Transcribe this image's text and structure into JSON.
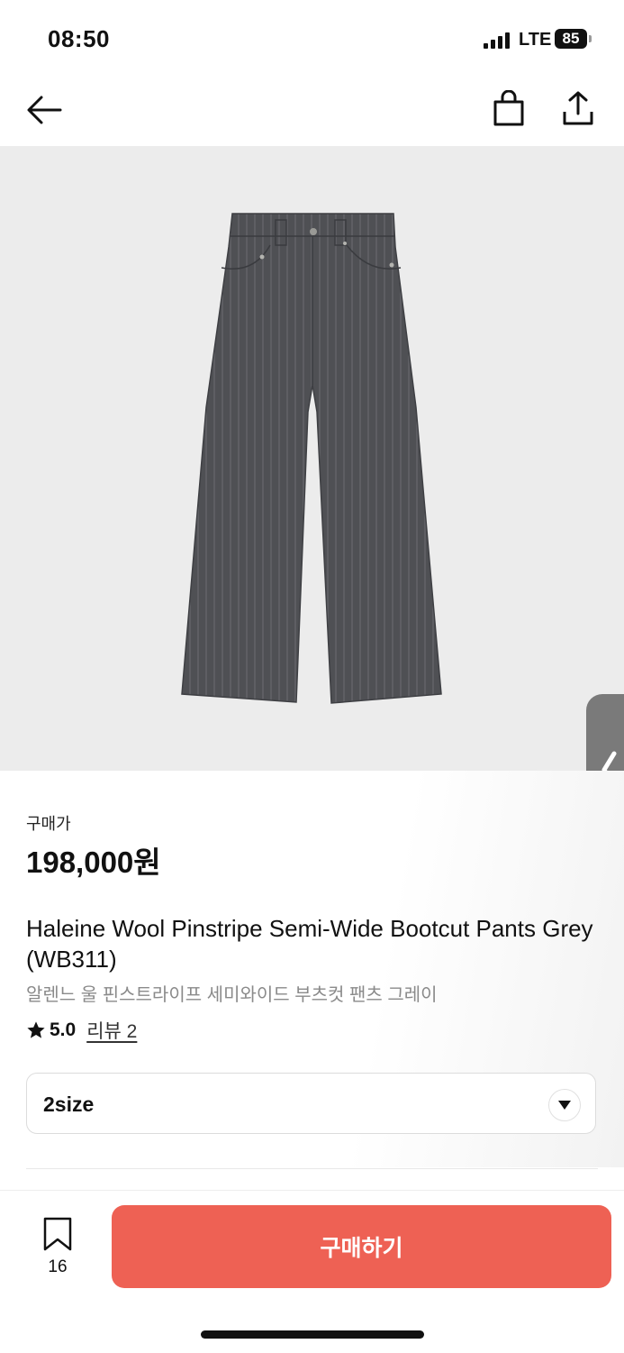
{
  "status_bar": {
    "time": "08:50",
    "network": "LTE",
    "battery": "85"
  },
  "nav": {
    "icons": [
      "back-arrow-icon",
      "shopping-bag-icon",
      "share-icon"
    ]
  },
  "product": {
    "price_label": "구매가",
    "price": "198,000원",
    "name_en": "Haleine Wool Pinstripe Semi-Wide Bootcut Pants Grey (WB311)",
    "name_ko": "알렌느 울 핀스트라이프 세미와이드 부츠컷 팬츠 그레이",
    "rating": "5.0",
    "review_link": "리뷰 2"
  },
  "size_select": {
    "selected": "2size"
  },
  "bottom": {
    "bookmark_count": "16",
    "buy_label": "구매하기"
  },
  "colors": {
    "accent": "#ee6154",
    "image_bg": "#ececec",
    "pants": "#4f5054"
  }
}
